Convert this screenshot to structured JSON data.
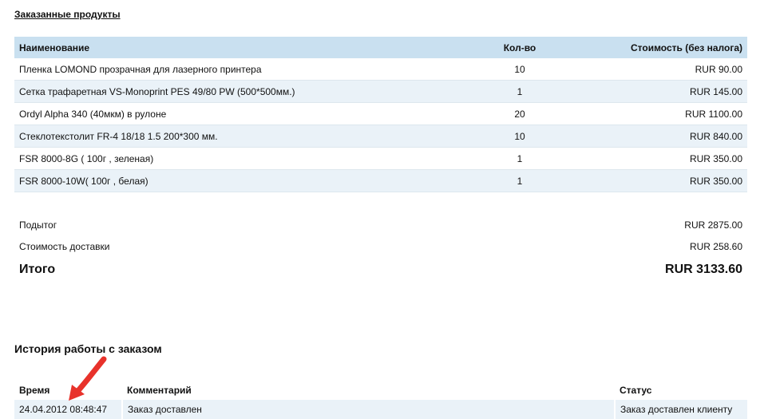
{
  "ordered_products_link": "Заказанные продукты",
  "products": {
    "headers": {
      "name": "Наименование",
      "qty": "Кол-во",
      "price": "Стоимость (без налога)"
    },
    "rows": [
      {
        "name": "Пленка LOMOND прозрачная для лазерного принтера",
        "qty": "10",
        "price": "RUR 90.00"
      },
      {
        "name": "Сетка трафаретная VS-Monoprint PES 49/80 PW (500*500мм.)",
        "qty": "1",
        "price": "RUR 145.00"
      },
      {
        "name": "Ordyl Alpha 340 (40мкм) в рулоне",
        "qty": "20",
        "price": "RUR 1100.00"
      },
      {
        "name": "Стеклотекстолит FR-4 18/18 1.5 200*300 мм.",
        "qty": "10",
        "price": "RUR 840.00"
      },
      {
        "name": "FSR 8000-8G ( 100г , зеленая)",
        "qty": "1",
        "price": "RUR 350.00"
      },
      {
        "name": "FSR 8000-10W( 100г , белая)",
        "qty": "1",
        "price": "RUR 350.00"
      }
    ]
  },
  "totals": {
    "subtotal_label": "Подытог",
    "subtotal_value": "RUR 2875.00",
    "shipping_label": "Стоимость доставки",
    "shipping_value": "RUR 258.60",
    "total_label": "Итого",
    "total_value": "RUR 3133.60"
  },
  "history": {
    "title": "История работы с заказом",
    "headers": {
      "time": "Время",
      "comment": "Комментарий",
      "status": "Статус"
    },
    "rows": [
      {
        "time": "24.04.2012 08:48:47",
        "comment": "Заказ доставлен",
        "status": "Заказ доставлен клиенту"
      }
    ]
  },
  "colors": {
    "header_bg": "#c9e0f0",
    "row_alt_bg": "#eaf2f8",
    "annotation_arrow": "#e8322b"
  },
  "icons": {
    "annotation": "red-arrow-icon"
  }
}
